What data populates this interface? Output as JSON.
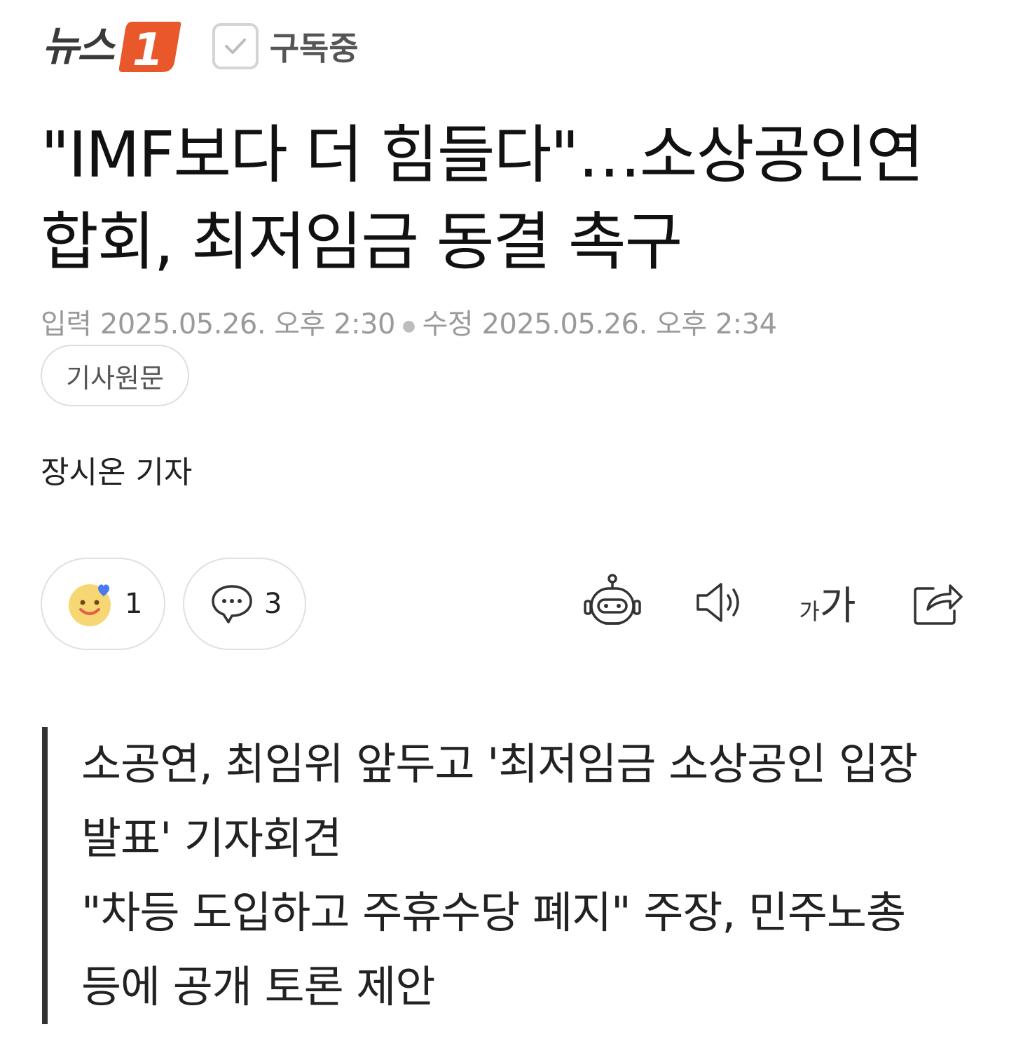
{
  "header": {
    "logo_text": "뉴스",
    "logo_number": "1",
    "subscribe_label": "구독중",
    "brand_color": "#e8582a"
  },
  "article": {
    "title": "\"IMF보다 더 힘들다\"…소상공인연합회, 최저임금 동결 촉구",
    "published_label": "입력",
    "published": "2025.05.26. 오후 2:30",
    "modified_label": "수정",
    "modified": "2025.05.26. 오후 2:34",
    "original_button": "기사원문",
    "reporter": "장시온 기자"
  },
  "actions": {
    "reaction_count": "1",
    "comment_count": "3",
    "font_small": "가",
    "font_large": "가",
    "icons": [
      "reaction-smile-icon",
      "comment-icon",
      "robot-summary-icon",
      "speaker-icon",
      "font-size-icon",
      "share-icon"
    ]
  },
  "summary": [
    "소공연, 최임위 앞두고 '최저임금 소상공인 입장 발표' 기자회견",
    "\"차등 도입하고 주휴수당 폐지\" 주장, 민주노총 등에 공개 토론 제안"
  ]
}
